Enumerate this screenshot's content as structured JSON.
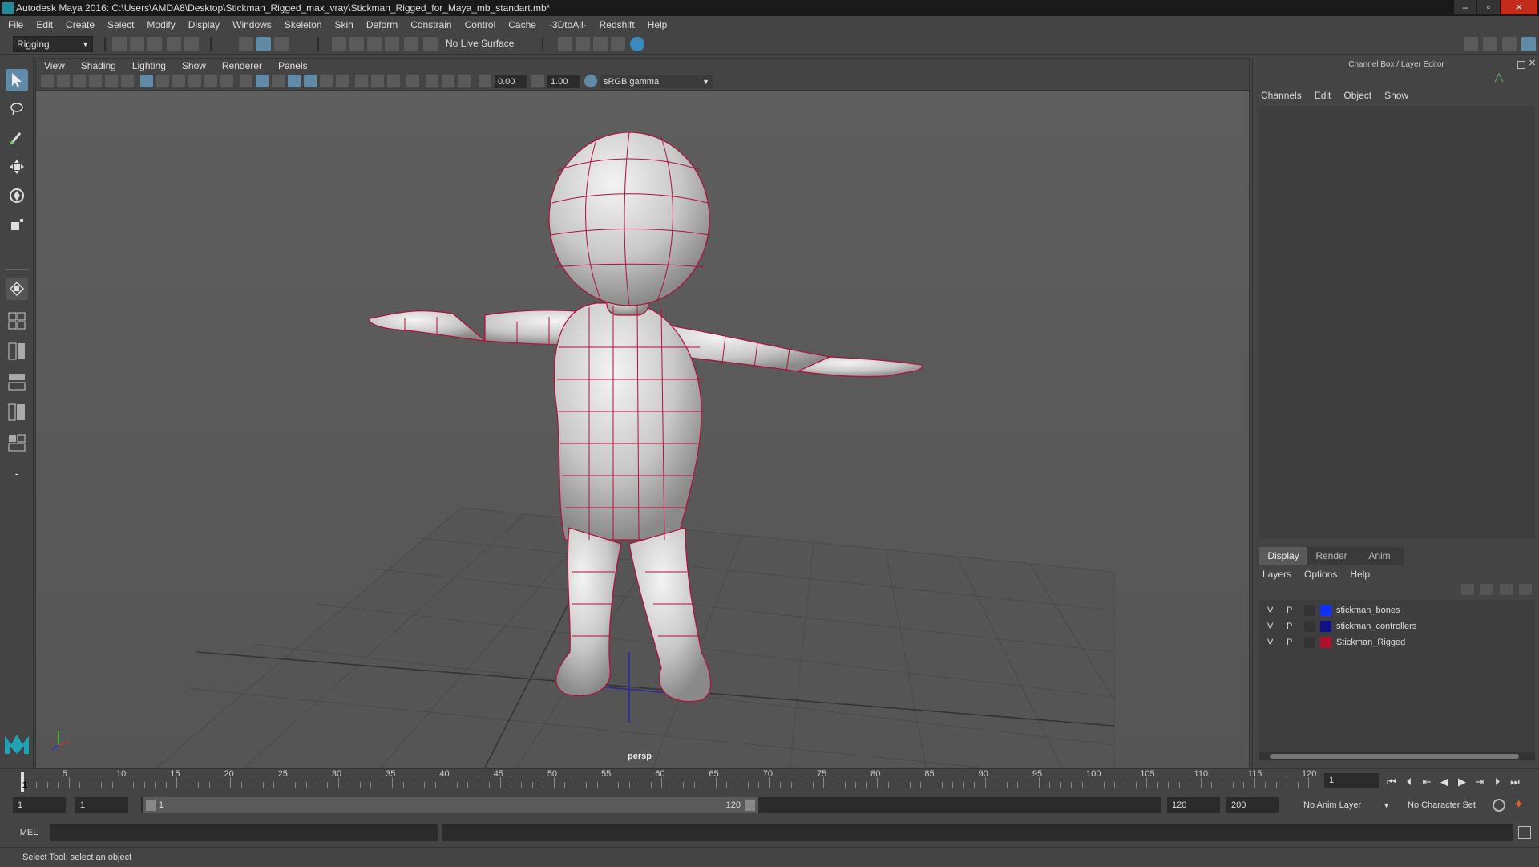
{
  "window": {
    "title": "Autodesk Maya 2016: C:\\Users\\AMDA8\\Desktop\\Stickman_Rigged_max_vray\\Stickman_Rigged_for_Maya_mb_standart.mb*",
    "minimize": "–",
    "maximize": "▫",
    "close": "✕"
  },
  "menubar": [
    "File",
    "Edit",
    "Create",
    "Select",
    "Modify",
    "Display",
    "Windows",
    "Skeleton",
    "Skin",
    "Deform",
    "Constrain",
    "Control",
    "Cache",
    "-3DtoAll-",
    "Redshift",
    "Help"
  ],
  "shelf": {
    "menuset": "Rigging",
    "live_surface": "No Live Surface"
  },
  "viewport": {
    "menus": [
      "View",
      "Shading",
      "Lighting",
      "Show",
      "Renderer",
      "Panels"
    ],
    "exposure": "0.00",
    "gamma": "1.00",
    "color_space": "sRGB gamma",
    "camera_label": "persp"
  },
  "channelbox": {
    "title": "Channel Box / Layer Editor",
    "menus": [
      "Channels",
      "Edit",
      "Object",
      "Show"
    ]
  },
  "layer_editor": {
    "tabs": [
      "Display",
      "Render",
      "Anim"
    ],
    "active_tab": "Display",
    "menus": [
      "Layers",
      "Options",
      "Help"
    ],
    "layers": [
      {
        "v": "V",
        "p": "P",
        "color": "#1030ff",
        "name": "stickman_bones"
      },
      {
        "v": "V",
        "p": "P",
        "color": "#10108a",
        "name": "stickman_controllers"
      },
      {
        "v": "V",
        "p": "P",
        "color": "#b01030",
        "name": "Stickman_Rigged"
      }
    ]
  },
  "timeline": {
    "ticks": [
      "1",
      "5",
      "10",
      "15",
      "20",
      "25",
      "30",
      "35",
      "40",
      "45",
      "50",
      "55",
      "60",
      "65",
      "70",
      "75",
      "80",
      "85",
      "90",
      "95",
      "100",
      "105",
      "110",
      "115",
      "120"
    ],
    "current_frame": "1",
    "current_frame_marker": "1"
  },
  "range": {
    "start": "1",
    "playback_start": "1",
    "slider_start": "1",
    "slider_end": "120",
    "playback_end": "120",
    "end": "200",
    "anim_layer": "No Anim Layer",
    "character_set": "No Character Set"
  },
  "command": {
    "lang": "MEL"
  },
  "status": {
    "help_line": "Select Tool: select an object"
  }
}
